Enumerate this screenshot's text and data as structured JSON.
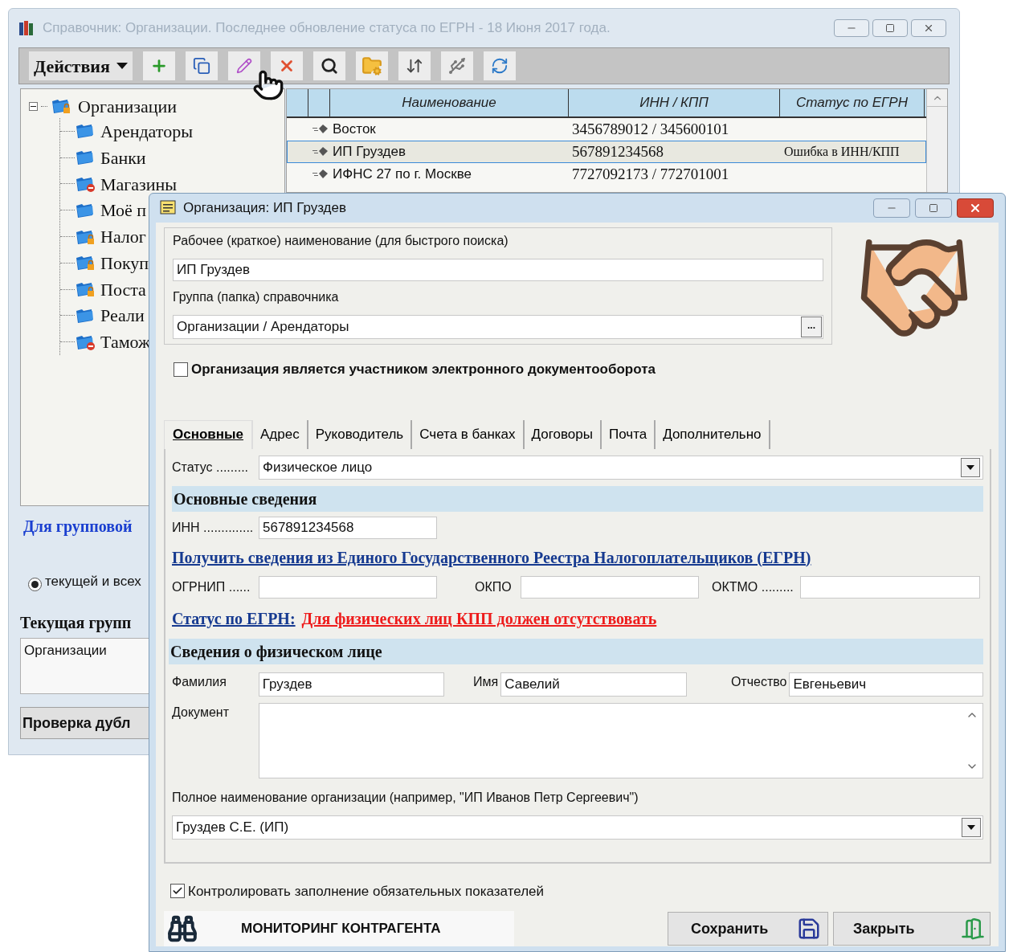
{
  "main_window": {
    "title": "Справочник: Организации. Последнее обновление статуса по ЕГРН - 18 Июня 2017 года.",
    "active": false
  },
  "toolbar": {
    "actions_label": "Действия",
    "buttons": [
      {
        "kind": "add"
      },
      {
        "kind": "copy"
      },
      {
        "kind": "edit"
      },
      {
        "kind": "delete"
      },
      {
        "kind": "search"
      },
      {
        "kind": "folder_settings"
      },
      {
        "kind": "swap"
      },
      {
        "kind": "usb_add"
      },
      {
        "kind": "usb_sync"
      }
    ]
  },
  "tree": {
    "label": "Организации",
    "kind": "locked",
    "expanded": true,
    "children": [
      {
        "label": "Арендаторы",
        "kind": "plain"
      },
      {
        "label": "Банки",
        "kind": "plain"
      },
      {
        "label": "Магазины",
        "kind": "blocked"
      },
      {
        "label": "Моё п",
        "kind": "plain"
      },
      {
        "label": "Налог",
        "kind": "locked"
      },
      {
        "label": "Покуп",
        "kind": "locked"
      },
      {
        "label": "Поста",
        "kind": "locked"
      },
      {
        "label": "Реали",
        "kind": "plain"
      },
      {
        "label": "Тамож",
        "kind": "blocked"
      }
    ]
  },
  "table": {
    "columns": [
      "Наименование",
      "ИНН / КПП",
      "Статус по ЕГРН"
    ],
    "rows": [
      {
        "name": "Восток",
        "inn_kpp": "3456789012 / 345600101",
        "selected": false
      },
      {
        "name": "ИП Груздев",
        "inn_kpp": "567891234568",
        "status": "Ошибка в ИНН/КПП",
        "selected": true
      },
      {
        "name": "ИФНС 27 по г. Москве",
        "inn_kpp": "7727092173 / 772701001",
        "selected": false
      }
    ]
  },
  "group_panel": {
    "title": "Для групповой",
    "radio": {
      "label": "текущей и всех",
      "selected": true
    },
    "current_group_label": "Текущая групп",
    "current_group": "Организации",
    "check_button": "Проверка дубл"
  },
  "dialog": {
    "title": "Организация: ИП Груздев",
    "short_name_label": "Рабочее (краткое) наименование (для быстрого поиска)",
    "short_name": "ИП Груздев",
    "group_label": "Группа (папка) справочника",
    "group": "Организации / Арендаторы",
    "group_browse": "...",
    "edo_checkbox": {
      "label": "Организация является участником электронного документооборота",
      "checked": false
    },
    "tabs": [
      {
        "label": "Основные",
        "selected": true
      },
      {
        "label": "Адрес",
        "selected": false
      },
      {
        "label": "Руководитель",
        "selected": false
      },
      {
        "label": "Счета в банках",
        "selected": false
      },
      {
        "label": "Договоры",
        "selected": false
      },
      {
        "label": "Почта",
        "selected": false
      },
      {
        "label": "Дополнительно",
        "selected": false
      }
    ],
    "status_label": "Статус .........",
    "status": "Физическое лицо",
    "main_section": "Основные сведения",
    "inn_label": "ИНН ..............",
    "inn": "567891234568",
    "egrn_link": "Получить сведения из Единого Государственного Реестра Налогоплательщиков (ЕГРН)",
    "ogrnip_label": "ОГРНИП ......",
    "okpo_label": "ОКПО",
    "oktmo_label": "ОКТМО .........",
    "egrn_status_label": "Статус по ЕГРН:",
    "egrn_status": "Для физических лиц КПП должен отсутствовать",
    "person_section": "Сведения о физическом лице",
    "surname_label": "Фамилия",
    "surname": "Груздев",
    "name_label": "Имя",
    "name": "Савелий",
    "patronymic_label": "Отчество",
    "patronymic": "Евгеньевич",
    "document_label": "Документ",
    "full_name_label": "Полное наименование организации (например, \"ИП Иванов Петр Сергеевич\")",
    "full_name": "Груздев С.Е. (ИП)",
    "control_checkbox": {
      "label": "Контролировать заполнение обязательных показателей",
      "checked": true
    },
    "monitoring_button": "МОНИТОРИНГ КОНТРАГЕНТА",
    "save_button": "Сохранить",
    "close_button": "Закрыть"
  }
}
